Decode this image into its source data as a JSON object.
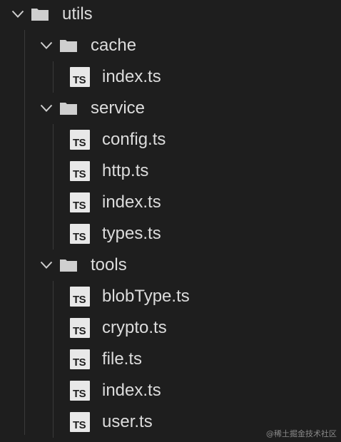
{
  "explorer": {
    "items": [
      {
        "label": "utils",
        "type": "folder",
        "depth": 0,
        "expanded": true,
        "icon": "folder-icon"
      },
      {
        "label": "cache",
        "type": "folder",
        "depth": 1,
        "expanded": true,
        "icon": "folder-icon"
      },
      {
        "label": "index.ts",
        "type": "ts",
        "depth": 2,
        "icon": "typescript-file-icon"
      },
      {
        "label": "service",
        "type": "folder",
        "depth": 1,
        "expanded": true,
        "icon": "folder-icon"
      },
      {
        "label": "config.ts",
        "type": "ts",
        "depth": 2,
        "icon": "typescript-file-icon"
      },
      {
        "label": "http.ts",
        "type": "ts",
        "depth": 2,
        "icon": "typescript-file-icon"
      },
      {
        "label": "index.ts",
        "type": "ts",
        "depth": 2,
        "icon": "typescript-file-icon"
      },
      {
        "label": "types.ts",
        "type": "ts",
        "depth": 2,
        "icon": "typescript-file-icon"
      },
      {
        "label": "tools",
        "type": "folder",
        "depth": 1,
        "expanded": true,
        "icon": "folder-icon"
      },
      {
        "label": "blobType.ts",
        "type": "ts",
        "depth": 2,
        "icon": "typescript-file-icon"
      },
      {
        "label": "crypto.ts",
        "type": "ts",
        "depth": 2,
        "icon": "typescript-file-icon"
      },
      {
        "label": "file.ts",
        "type": "ts",
        "depth": 2,
        "icon": "typescript-file-icon"
      },
      {
        "label": "index.ts",
        "type": "ts",
        "depth": 2,
        "icon": "typescript-file-icon"
      },
      {
        "label": "user.ts",
        "type": "ts",
        "depth": 2,
        "icon": "typescript-file-icon"
      }
    ],
    "ts_badge": "TS"
  },
  "watermark": "@稀土掘金技术社区",
  "colors": {
    "background": "#1e1e1e",
    "text": "#dcdcdc",
    "ts_icon_bg": "#e8e8e8",
    "indent_guide": "#3a3a3a"
  }
}
